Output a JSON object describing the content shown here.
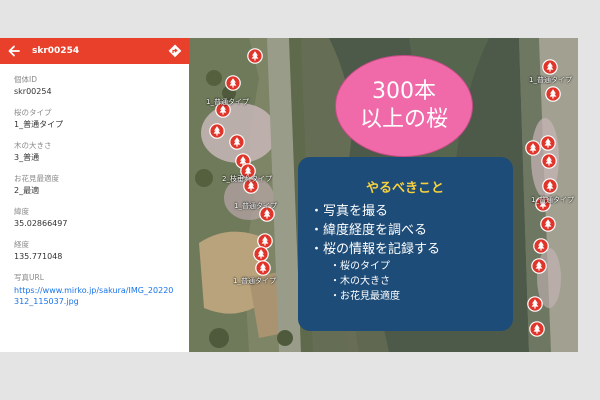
{
  "panel": {
    "title": "skr00254",
    "fields": [
      {
        "label": "個体ID",
        "value": "skr00254"
      },
      {
        "label": "桜のタイプ",
        "value": "1_普通タイプ"
      },
      {
        "label": "木の大きさ",
        "value": "3_普通"
      },
      {
        "label": "お花見最適度",
        "value": "2_最適"
      },
      {
        "label": "緯度",
        "value": "35.02866497"
      },
      {
        "label": "経度",
        "value": "135.771048"
      },
      {
        "label": "写真URL",
        "value": "https://www.mirko.jp/sakura/IMG_20220312_115037.jpg"
      }
    ]
  },
  "map": {
    "labels": [
      "1_普通タイプ",
      "2_枝垂れタイプ",
      "1_普通タイプ",
      "1_普通タイプ",
      "1_普通タイプ",
      "1_普通タイプ"
    ],
    "pin_icon": "cherry-tree-icon",
    "pin_color": "#e0352b",
    "pin_count": 24
  },
  "bubble": {
    "line1": "300本",
    "line2": "以上の桜"
  },
  "todo": {
    "title": "やるべきこと",
    "items": [
      "・写真を撮る",
      "・緯度経度を調べる",
      "・桜の情報を記録する"
    ],
    "subitems": [
      "・桜のタイプ",
      "・木の大きさ",
      "・お花見最適度"
    ]
  },
  "colors": {
    "header": "#e8402a",
    "bubble": "#f06aa9",
    "todo_box": "#1e4c78",
    "todo_title": "#f7d13d",
    "link": "#1a73e8"
  }
}
